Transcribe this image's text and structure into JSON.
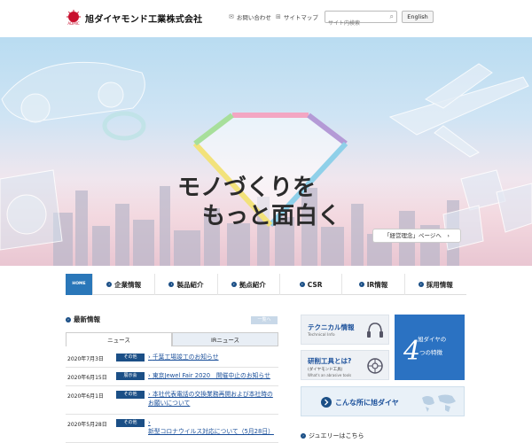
{
  "header": {
    "company_name": "旭ダイヤモンド工業株式会社",
    "logo_sub": "ADMIC",
    "contact_label": "お問い合わせ",
    "sitemap_label": "サイトマップ",
    "search_placeholder": "サイト内検索",
    "english_label": "English"
  },
  "hero": {
    "headline_line1": "モノづくりを",
    "headline_line2": "もっと面白く",
    "philosophy_link": "「経営理念」ページへ　›"
  },
  "nav": {
    "home_label": "HOME",
    "items": [
      {
        "label": "企業情報"
      },
      {
        "label": "製品紹介"
      },
      {
        "label": "拠点紹介"
      },
      {
        "label": "CSR"
      },
      {
        "label": "IR情報"
      },
      {
        "label": "採用情報"
      }
    ]
  },
  "news": {
    "heading": "最新情報",
    "list_button": "一覧へ",
    "tabs": [
      {
        "label": "ニュース"
      },
      {
        "label": "IRニュース"
      }
    ],
    "items": [
      {
        "date": "2020年7月3日",
        "badge": "その他",
        "title": "千葉工場竣工のお知らせ"
      },
      {
        "date": "2020年6月15日",
        "badge": "展示会",
        "title": "東京Jewel Fair 2020　開催中止のお知らせ"
      },
      {
        "date": "2020年6月1日",
        "badge": "その他",
        "title": "本社代表電話の交換業務再開および本社時のお願いについて"
      },
      {
        "date": "2020年5月28日",
        "badge": "その他",
        "title": "新型コロナウイルス対応について（5月28日）"
      }
    ]
  },
  "side": {
    "tech_title": "テクニカル情報",
    "tech_sub": "Technical Info",
    "abrasive_title": "研削工具とは?",
    "abrasive_sub1": "(ダイヤモンド工具)",
    "abrasive_sub2": "What's an abrasive tools",
    "feature_pre": "旭ダイヤの",
    "feature_num": "4",
    "feature_post": "つの特徴",
    "banner_text": "こんな所に旭ダイヤ",
    "jewelry_link": "ジュエリーはこちら"
  },
  "colors": {
    "accent": "#2a77b9",
    "navy": "#1b4f86",
    "link": "#1a4f9a",
    "logo_red": "#c8102e"
  }
}
